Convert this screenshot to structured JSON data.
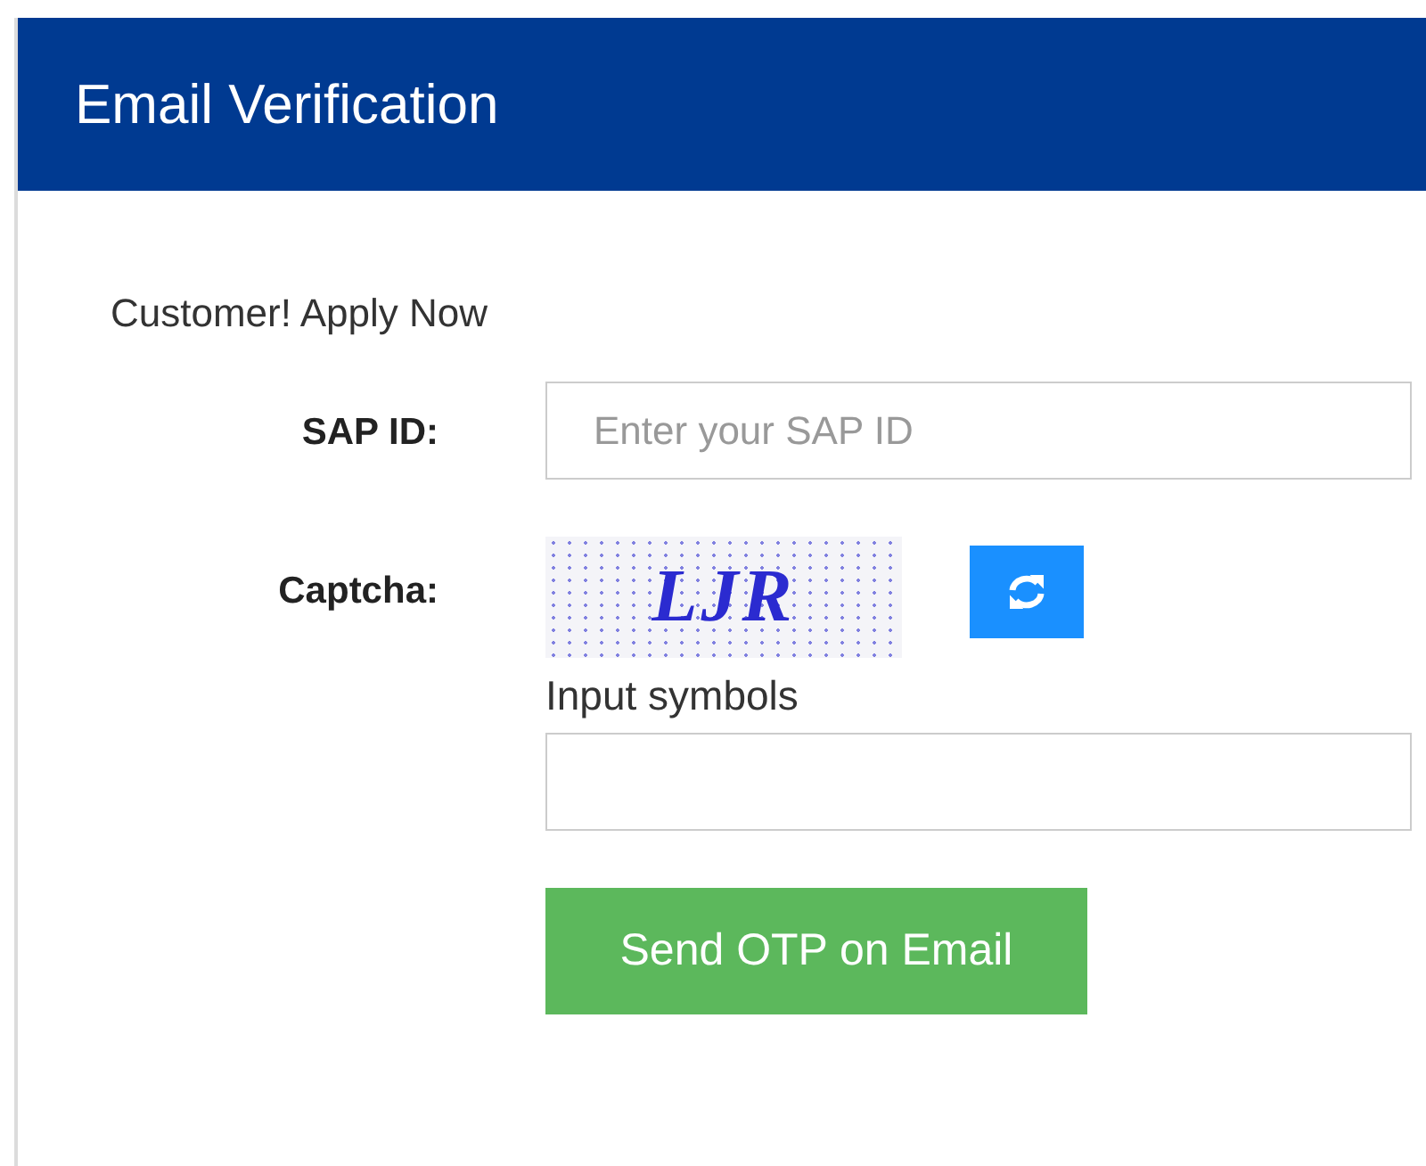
{
  "header": {
    "title": "Email Verification"
  },
  "intro": "Customer! Apply Now",
  "sap_id": {
    "label": "SAP ID:",
    "placeholder": "Enter your SAP ID"
  },
  "captcha": {
    "label": "Captcha:",
    "captcha_text": "LJR",
    "input_label": "Input symbols"
  },
  "submit_button": "Send OTP on Email"
}
